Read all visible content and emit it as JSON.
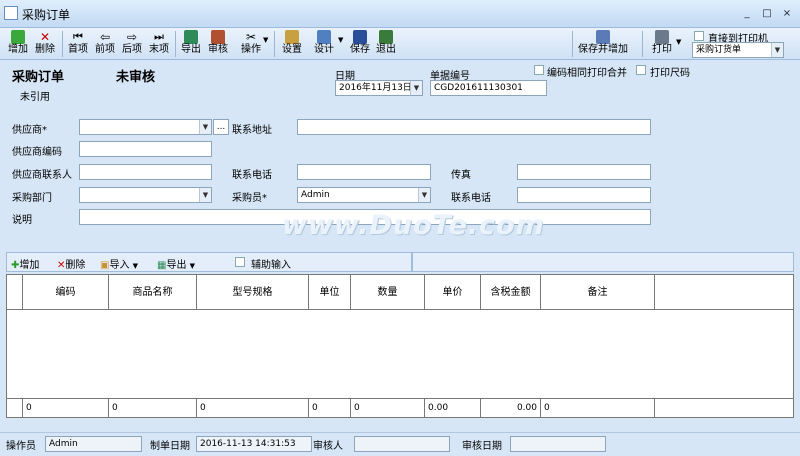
{
  "window": {
    "title": "采购订单",
    "controls": [
      "_",
      "□",
      "×"
    ]
  },
  "toolbar": {
    "add": "增加",
    "delete": "删除",
    "first": "首项",
    "prev": "前项",
    "next": "后项",
    "last": "末项",
    "export": "导出",
    "audit": "审核",
    "operate": "操作",
    "settings": "设置",
    "design": "设计",
    "save": "保存",
    "exit": "退出",
    "save_add": "保存并增加",
    "print": "打印",
    "direct_print": "直接到打印机",
    "print_template": "采购订货单"
  },
  "header": {
    "title": "采购订单",
    "status": "未审核",
    "ref_status": "未引用",
    "date_label": "日期",
    "date_value": "2016年11月13日",
    "docno_label": "单据编号",
    "docno_value": "CGD201611130301",
    "merge_label": "编码相同打印合并",
    "print_size_label": "打印尺码"
  },
  "form": {
    "supplier_label": "供应商*",
    "contact_addr_label": "联系地址",
    "supplier_code_label": "供应商编码",
    "supplier_contact_label": "供应商联系人",
    "phone_label": "联系电话",
    "fax_label": "传真",
    "dept_label": "采购部门",
    "buyer_label": "采购员*",
    "buyer_value": "Admin",
    "phone2_label": "联系电话",
    "note_label": "说明",
    "ellipsis": "..."
  },
  "watermark": "www.DuoTe.com",
  "grid": {
    "toolbar": {
      "add": "增加",
      "delete": "删除",
      "import": "导入",
      "export": "导出",
      "aux_input": "辅助输入"
    },
    "columns": [
      "编码",
      "商品名称",
      "型号规格",
      "单位",
      "数量",
      "单价",
      "含税金额",
      "备注"
    ],
    "totals": [
      "0",
      "0",
      "0",
      "0",
      "0",
      "0.00",
      "0.00",
      "0"
    ]
  },
  "status": {
    "operator_label": "操作员",
    "operator_value": "Admin",
    "created_label": "制单日期",
    "created_value": "2016-11-13 14:31:53",
    "auditor_label": "审核人",
    "audit_date_label": "审核日期"
  }
}
